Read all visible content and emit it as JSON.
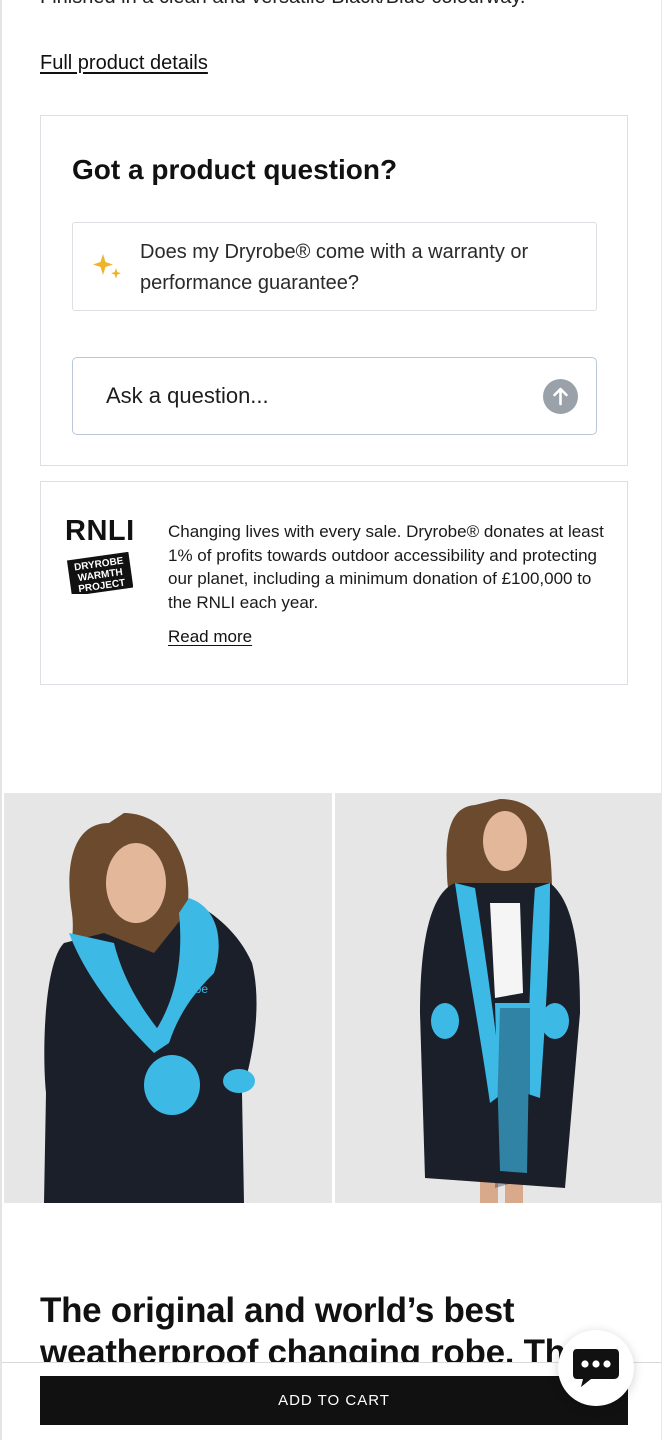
{
  "description": {
    "cut_line": "Finished in a clean and versatile Black/Blue colourway.",
    "full_details_link": "Full product details"
  },
  "qa": {
    "title": "Got a product question?",
    "suggestion": "Does my Dryrobe® come with a warranty or performance guarantee?",
    "input_placeholder": "Ask a question...",
    "sparkle_icon": "sparkle-icon",
    "send_icon": "arrow-up-icon"
  },
  "rnli": {
    "logo_text": "RNLI",
    "badge_lines": [
      "DRYROBE",
      "WARMTH",
      "PROJECT"
    ],
    "body": "Changing lives with every sale. Dryrobe® donates at least 1% of profits towards outdoor accessibility and protecting our planet, including a minimum donation of £100,000 to the RNLI each year.",
    "read_more": "Read more"
  },
  "gallery": {
    "images": [
      {
        "alt": "Woman wearing black Dryrobe with blue lining"
      },
      {
        "alt": "Woman wearing open black Dryrobe with blue lining"
      }
    ]
  },
  "headline": "The original and world’s best weatherproof changing robe. The",
  "cart": {
    "button_label": "ADD TO CART"
  },
  "chat": {
    "icon": "chat-bubble-icon"
  },
  "colors": {
    "accent_black": "#111111",
    "robe_blue": "#3db9e6",
    "sparkle_gold": "#f0b429"
  }
}
